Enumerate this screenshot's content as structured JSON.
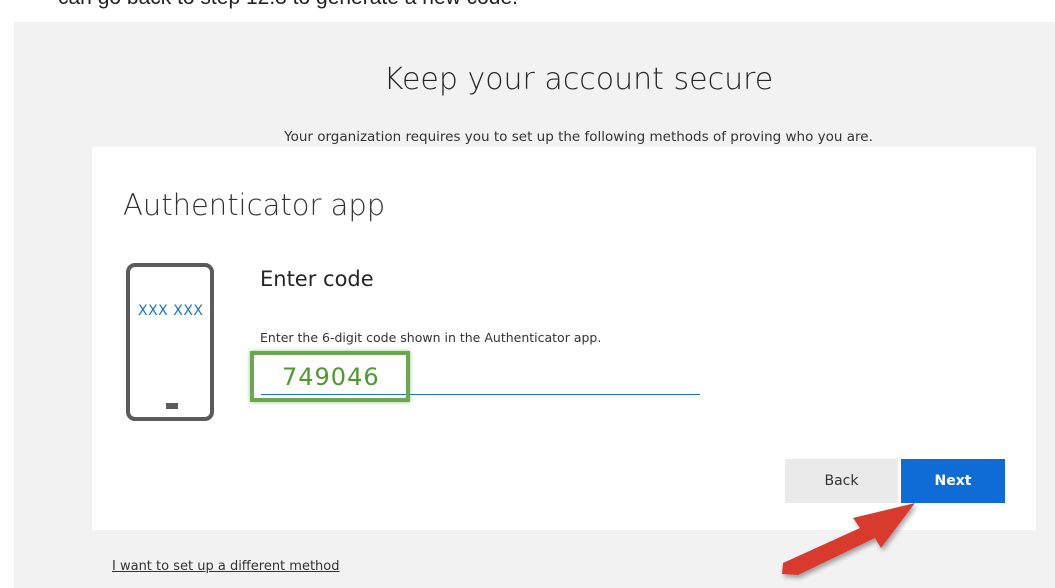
{
  "instruction_text": "can go back to step 12.3 to generate a new code.",
  "page": {
    "title": "Keep your account secure",
    "subtitle": "Your organization requires you to set up the following methods of proving who you are."
  },
  "card": {
    "title": "Authenticator app",
    "phone_code_placeholder": "XXX XXX",
    "step_heading": "Enter code",
    "step_description": "Enter the 6-digit code shown in the Authenticator app.",
    "code_value": "749046"
  },
  "buttons": {
    "back_label": "Back",
    "next_label": "Next"
  },
  "footer": {
    "alt_method_link": "I want to set up a different method"
  },
  "colors": {
    "accent": "#0f6cd6",
    "highlight_box": "#6aa84f",
    "annotation_arrow": "#d83b2f"
  },
  "icons": {
    "phone": "phone-icon",
    "arrow": "annotation-arrow-icon"
  }
}
